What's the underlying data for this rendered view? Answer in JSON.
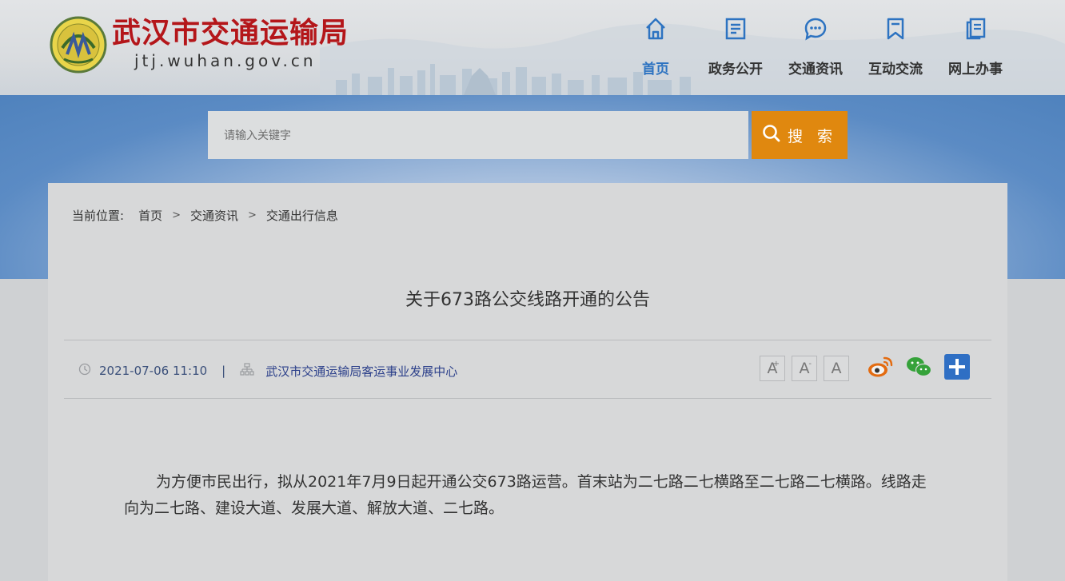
{
  "header": {
    "site_name": "武汉市交通运输局",
    "site_domain": "jtj.wuhan.gov.cn"
  },
  "nav": {
    "items": [
      {
        "label": "首页",
        "icon": "home-icon",
        "active": true
      },
      {
        "label": "政务公开",
        "icon": "document-icon",
        "active": false
      },
      {
        "label": "交通资讯",
        "icon": "chat-bubble-icon",
        "active": false
      },
      {
        "label": "互动交流",
        "icon": "bookmark-icon",
        "active": false
      },
      {
        "label": "网上办事",
        "icon": "copy-icon",
        "active": false
      }
    ]
  },
  "search": {
    "placeholder": "请输入关键字",
    "button_label": "搜 索"
  },
  "breadcrumb": {
    "prefix": "当前位置:",
    "items": [
      "首页",
      "交通资讯",
      "交通出行信息"
    ],
    "separator": ">"
  },
  "article": {
    "title": "关于673路公交线路开通的公告",
    "date": "2021-07-06 11:10",
    "divider": "|",
    "source": "武汉市交通运输局客运事业发展中心",
    "body": "为方便市民出行，拟从2021年7月9日起开通公交673路运营。首末站为二七路二七横路至二七路二七横路。线路走向为二七路、建设大道、发展大道、解放大道、二七路。"
  },
  "font_tools": {
    "large": "A",
    "large_mark": "+",
    "small": "A",
    "small_mark": "-",
    "normal": "A"
  },
  "colors": {
    "brand_red": "#b4161a",
    "nav_active": "#2d73c1",
    "search_button": "#e0880f",
    "share_plus": "#2f6fc4"
  }
}
